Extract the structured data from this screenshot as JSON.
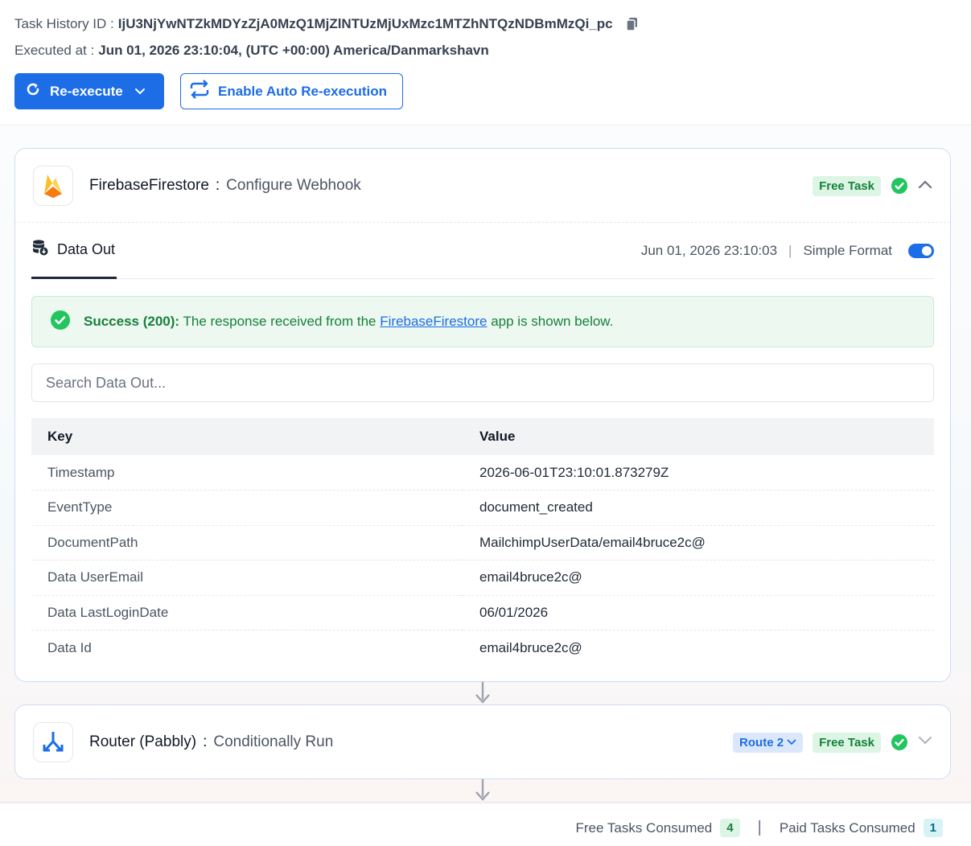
{
  "header": {
    "task_history_label": "Task History ID :",
    "task_history_id": "IjU3NjYwNTZkMDYzZjA0MzQ1MjZlNTUzMjUxMzc1MTZhNTQzNDBmMzQi_pc",
    "executed_label": "Executed at :",
    "executed_value": "Jun 01, 2026 23:10:04, (UTC +00:00) America/Danmarkshavn"
  },
  "actions": {
    "reexecute_label": "Re-execute",
    "auto_reexecution_label": "Enable Auto Re-execution"
  },
  "step1": {
    "app_name": "FirebaseFirestore",
    "colon": ":",
    "event_name": "Configure Webhook",
    "badge": "Free Task",
    "tab_label": "Data Out",
    "timestamp": "Jun 01, 2026 23:10:03",
    "separator": "|",
    "format_label": "Simple Format",
    "alert_status": "Success (200):",
    "alert_text_before": "The response received from the",
    "alert_link": "FirebaseFirestore",
    "alert_text_after": "app is shown below.",
    "search_placeholder": "Search Data Out...",
    "table": {
      "headers": [
        "Key",
        "Value"
      ],
      "rows": [
        {
          "key": "Timestamp",
          "value": "2026-06-01T23:10:01.873279Z"
        },
        {
          "key": "EventType",
          "value": "document_created"
        },
        {
          "key": "DocumentPath",
          "value": "MailchimpUserData/email4bruce2c@"
        },
        {
          "key": "Data UserEmail",
          "value": "email4bruce2c@"
        },
        {
          "key": "Data LastLoginDate",
          "value": "06/01/2026"
        },
        {
          "key": "Data Id",
          "value": "email4bruce2c@"
        }
      ]
    }
  },
  "step2": {
    "app_name": "Router (Pabbly)",
    "colon": ":",
    "event_name": "Conditionally Run",
    "route_badge": "Route 2",
    "badge": "Free Task"
  },
  "footer": {
    "free_label": "Free Tasks Consumed",
    "free_count": "4",
    "separator": "|",
    "paid_label": "Paid Tasks Consumed",
    "paid_count": "1"
  },
  "colors": {
    "primary": "#1c6de6",
    "success": "#16803c",
    "success_bg": "#edf8f0"
  },
  "icons": [
    "copy-icon",
    "refresh-icon",
    "chevron-down-icon",
    "repeat-icon",
    "firebase-icon",
    "check-circle-icon",
    "chevron-up-icon",
    "database-icon",
    "router-icon",
    "arrow-down-icon"
  ]
}
